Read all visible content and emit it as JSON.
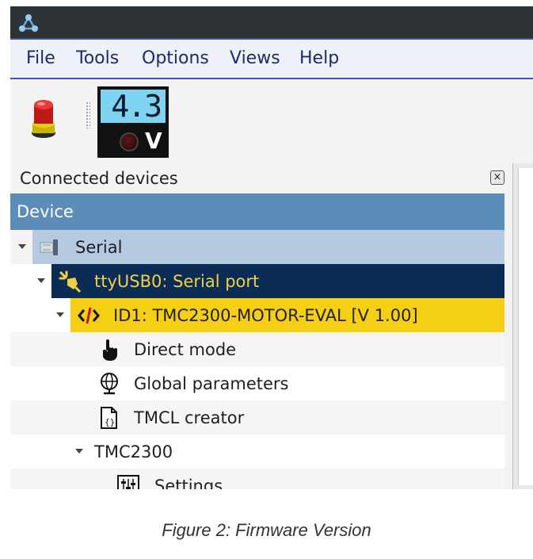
{
  "menu": {
    "items": [
      {
        "label": "File"
      },
      {
        "label": "Tools"
      },
      {
        "label": "Options"
      },
      {
        "label": "Views"
      },
      {
        "label": "Help"
      }
    ]
  },
  "toolbar": {
    "emergency_stop_icon": "emergency-stop-icon",
    "voltage": {
      "value": "4.3",
      "unit": "V"
    }
  },
  "panel": {
    "title": "Connected devices",
    "close_glyph": "×",
    "column_header": "Device"
  },
  "tree": {
    "serial": "Serial",
    "port": "ttyUSB0: Serial port",
    "module": "ID1: TMC2300-MOTOR-EVAL [V 1.00]",
    "direct_mode": "Direct mode",
    "global_parameters": "Global parameters",
    "tmcl_creator": "TMCL creator",
    "ic": "TMC2300",
    "settings": "Settings"
  },
  "colors": {
    "port_row_bg": "#0b2c55",
    "port_row_text": "#f2d046",
    "module_row_bg": "#f5cf13",
    "serial_row_bg": "#b5cae0",
    "header_bg": "#5c8cb8"
  },
  "caption": "Figure 2: Firmware Version"
}
